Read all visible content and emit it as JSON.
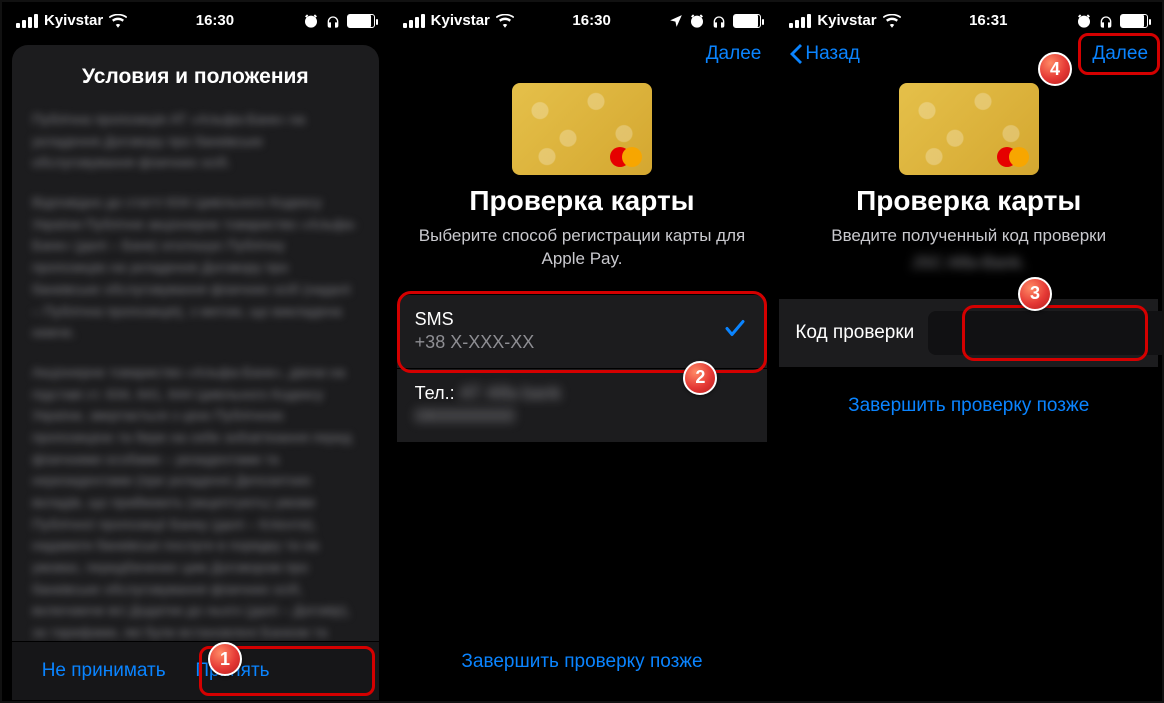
{
  "status": {
    "carrier": "Kyivstar",
    "time_a": "16:30",
    "time_b": "16:30",
    "time_c": "16:31"
  },
  "screen1": {
    "title": "Условия и положения",
    "decline": "Не принимать",
    "accept": "Принять",
    "badge": "1"
  },
  "screen2": {
    "next": "Далее",
    "heading": "Проверка карты",
    "subtitle": "Выберите способ регистрации карты для Apple Pay.",
    "opt_sms_label": "SMS",
    "opt_sms_detail": "+38  X-XXX-XX",
    "opt_tel_label": "Тел.:",
    "later": "Завершить проверку позже",
    "badge": "2"
  },
  "screen3": {
    "back": "Назад",
    "next": "Далее",
    "heading": "Проверка карты",
    "subtitle": "Введите полученный код проверки",
    "code_label": "Код проверки",
    "later": "Завершить проверку позже",
    "badge_input": "3",
    "badge_next": "4"
  }
}
